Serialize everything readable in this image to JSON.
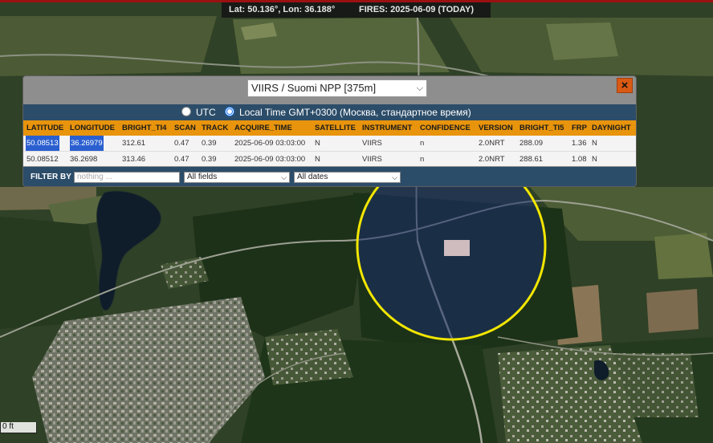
{
  "status": {
    "coords": "Lat: 50.136°, Lon: 36.188°",
    "fires": "FIRES: 2025-06-09 (TODAY)"
  },
  "panel": {
    "satellite_selected": "VIIRS / Suomi NPP [375m]",
    "close_label": "×",
    "tz_utc": "UTC",
    "tz_local": "Local Time GMT+0300 (Москва, стандартное время)",
    "columns": [
      "LATITUDE",
      "LONGITUDE",
      "BRIGHT_TI4",
      "SCAN",
      "TRACK",
      "ACQUIRE_TIME",
      "SATELLITE",
      "INSTRUMENT",
      "CONFIDENCE",
      "VERSION",
      "BRIGHT_TI5",
      "FRP",
      "DAYNIGHT"
    ],
    "rows": [
      [
        "50.08513",
        "36.26979",
        "312.61",
        "0.47",
        "0.39",
        "2025-06-09 03:03:00",
        "N",
        "VIIRS",
        "n",
        "2.0NRT",
        "288.09",
        "1.36",
        "N"
      ],
      [
        "50.08512",
        "36.2698",
        "313.46",
        "0.47",
        "0.39",
        "2025-06-09 03:03:00",
        "N",
        "VIIRS",
        "n",
        "2.0NRT",
        "288.61",
        "1.08",
        "N"
      ]
    ],
    "filter_label": "FILTER BY",
    "filter_placeholder": "nothing ...",
    "field_select": "All fields",
    "date_select": "All dates"
  },
  "map": {
    "scale_label": "0 ft"
  },
  "colors": {
    "accent": "#e8940c",
    "header_blue": "#2c4d69",
    "circle": "#f2e600",
    "close": "#d85a14"
  }
}
